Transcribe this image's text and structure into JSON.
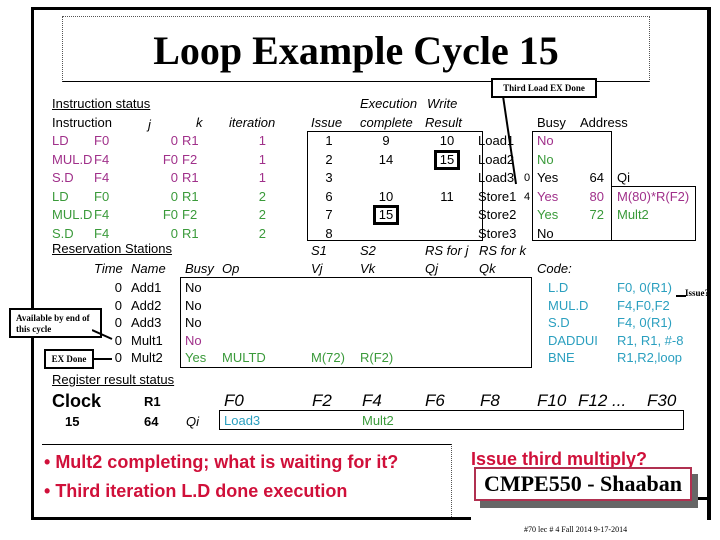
{
  "title": "Loop Example Cycle 15",
  "callouts": {
    "third_load": "Third Load EX Done",
    "available": "Available by end of this cycle",
    "ex_done": "EX Done",
    "issue": "Issue?"
  },
  "instruction_status": {
    "heading": "Instruction status",
    "headers": {
      "instruction": "Instruction",
      "j": "j",
      "k": "k",
      "iteration": "iteration",
      "issue": "Issue",
      "exec_top": "Execution",
      "exec_bottom": "complete",
      "write_top": "Write",
      "write_bottom": "Result"
    },
    "rows": [
      {
        "op": "LD",
        "dest": "F0",
        "j": "0",
        "k": "R1",
        "iteration": "1",
        "issue": "1",
        "exec": "9",
        "write": "10",
        "color": "mag"
      },
      {
        "op": "MUL.D",
        "dest": "F4",
        "j": "F0",
        "k": "F2",
        "iteration": "1",
        "issue": "2",
        "exec": "14",
        "write": "15",
        "color": "mag"
      },
      {
        "op": "S.D",
        "dest": "F4",
        "j": "0",
        "k": "R1",
        "iteration": "1",
        "issue": "3",
        "exec": "",
        "write": "",
        "color": "mag"
      },
      {
        "op": "LD",
        "dest": "F0",
        "j": "0",
        "k": "R1",
        "iteration": "2",
        "issue": "6",
        "exec": "10",
        "write": "11",
        "color": "grn"
      },
      {
        "op": "MUL.D",
        "dest": "F4",
        "j": "F0",
        "k": "F2",
        "iteration": "2",
        "issue": "7",
        "exec": "15",
        "write": "",
        "color": "grn"
      },
      {
        "op": "S.D",
        "dest": "F4",
        "j": "0",
        "k": "R1",
        "iteration": "2",
        "issue": "8",
        "exec": "",
        "write": "",
        "color": "grn"
      }
    ]
  },
  "load_store_buffers": {
    "headers": {
      "busy": "Busy",
      "address": "Address",
      "qi": "Qi"
    },
    "rows": [
      {
        "name": "Load1",
        "count": "",
        "busy": "No",
        "address": "",
        "qi": "",
        "color": "mag"
      },
      {
        "name": "Load2",
        "count": "",
        "busy": "No",
        "address": "",
        "qi": "",
        "color": "grn"
      },
      {
        "name": "Load3",
        "count": "0",
        "busy": "Yes",
        "address": "64",
        "qi": "",
        "color": "blk"
      },
      {
        "name": "Store1",
        "count": "4",
        "busy": "Yes",
        "address": "80",
        "qi": "M(80)*R(F2)",
        "color": "mag"
      },
      {
        "name": "Store2",
        "count": "",
        "busy": "Yes",
        "address": "72",
        "qi": "Mult2",
        "color": "grn"
      },
      {
        "name": "Store3",
        "count": "",
        "busy": "No",
        "address": "",
        "qi": "",
        "color": "blk"
      }
    ]
  },
  "reservation_stations": {
    "heading": "Reservation Stations",
    "headers": {
      "time": "Time",
      "name": "Name",
      "busy": "Busy",
      "op": "Op",
      "s1": "S1",
      "vj": "Vj",
      "s2": "S2",
      "vk": "Vk",
      "rsj": "RS for j",
      "qj": "Qj",
      "rsk": "RS for k",
      "qk": "Qk"
    },
    "rows": [
      {
        "time": "0",
        "name": "Add1",
        "busy": "No",
        "op": "",
        "vj": "",
        "vk": "",
        "qj": "",
        "qk": "",
        "color": "blk"
      },
      {
        "time": "0",
        "name": "Add2",
        "busy": "No",
        "op": "",
        "vj": "",
        "vk": "",
        "qj": "",
        "qk": "",
        "color": "blk"
      },
      {
        "time": "0",
        "name": "Add3",
        "busy": "No",
        "op": "",
        "vj": "",
        "vk": "",
        "qj": "",
        "qk": "",
        "color": "blk"
      },
      {
        "time": "0",
        "name": "Mult1",
        "busy": "No",
        "op": "",
        "vj": "",
        "vk": "",
        "qj": "",
        "qk": "",
        "color": "mag"
      },
      {
        "time": "0",
        "name": "Mult2",
        "busy": "Yes",
        "op": "MULTD",
        "vj": "M(72)",
        "vk": "R(F2)",
        "qj": "",
        "qk": "",
        "color": "grn"
      }
    ]
  },
  "code": {
    "heading": "Code:",
    "lines": [
      {
        "op": "L.D",
        "args": "F0, 0(R1)"
      },
      {
        "op": "MUL.D",
        "args": "F4,F0,F2"
      },
      {
        "op": "S.D",
        "args": "F4, 0(R1)"
      },
      {
        "op": "DADDUI",
        "args": "R1, R1, #-8"
      },
      {
        "op": "BNE",
        "args": "R1,R2,loop"
      }
    ]
  },
  "register_status": {
    "heading": "Register result status",
    "clock_label": "Clock",
    "clock_value": "15",
    "r1_label": "R1",
    "r1_value": "64",
    "qi_label": "Qi",
    "registers": [
      "F0",
      "F2",
      "F4",
      "F6",
      "F8",
      "F10",
      "F12 ...",
      "F30"
    ],
    "values": {
      "F0": "Load3",
      "F4": "Mult2"
    }
  },
  "notes": {
    "bullet1": "Mult2 completing; what is waiting for it?",
    "bullet2": "Third iteration L.D done execution",
    "question": "Issue third multiply?"
  },
  "footer": {
    "brand": "CMPE550 - Shaaban",
    "info": "#70  lec # 4 Fall 2014   9-17-2014"
  },
  "colors": {
    "iteration1": "#a0308a",
    "iteration2": "#3a9a3a",
    "code": "#2a9fbf",
    "notes": "#d0103a"
  }
}
